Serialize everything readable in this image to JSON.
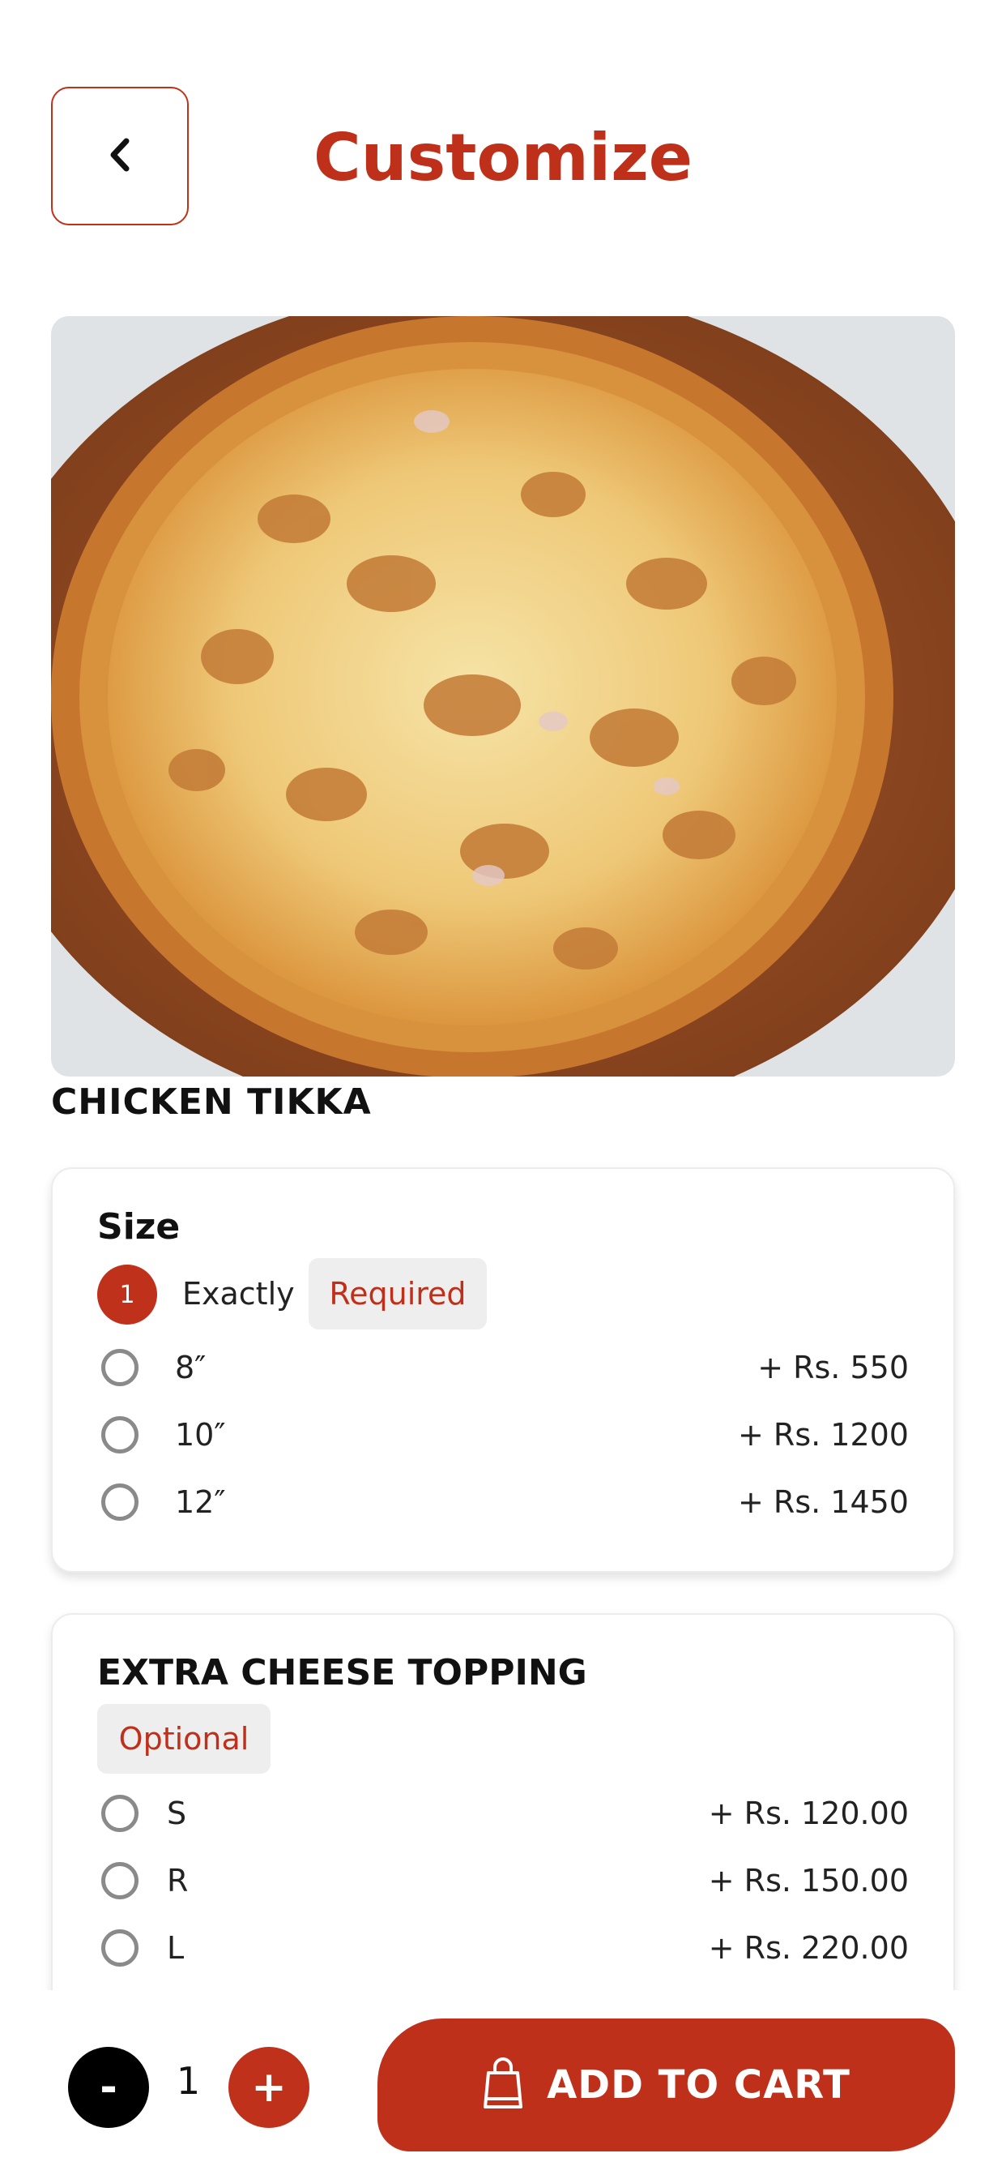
{
  "header": {
    "title": "Customize",
    "back_icon": "chevron-left-icon"
  },
  "product": {
    "name": "CHICKEN TIKKA",
    "image": "pizza-photo"
  },
  "size_group": {
    "title": "Size",
    "count": "1",
    "rule": "Exactly",
    "badge": "Required",
    "options": [
      {
        "label": "8″",
        "price": "+ Rs. 550"
      },
      {
        "label": "10″",
        "price": "+ Rs. 1200"
      },
      {
        "label": "12″",
        "price": "+ Rs. 1450"
      }
    ]
  },
  "cheese_group": {
    "title": "EXTRA CHEESE TOPPING",
    "badge": "Optional",
    "options": [
      {
        "label": "S",
        "price": "+ Rs. 120.00"
      },
      {
        "label": "R",
        "price": "+ Rs. 150.00"
      },
      {
        "label": "L",
        "price": "+ Rs. 220.00"
      }
    ]
  },
  "cart": {
    "minus_label": "-",
    "quantity": "1",
    "plus_label": "+",
    "button_label": "ADD TO CART",
    "bag_icon": "shopping-bag-icon"
  },
  "colors": {
    "accent": "#bf301b",
    "badge_bg": "#eeeeee"
  }
}
